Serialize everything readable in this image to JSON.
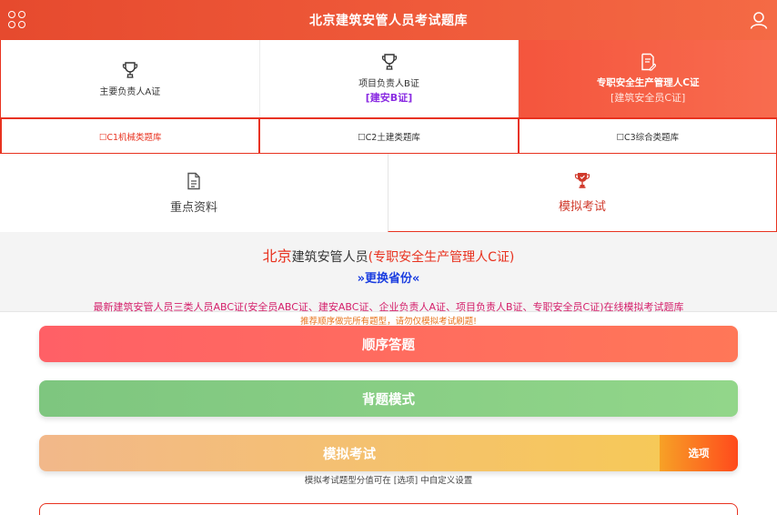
{
  "header": {
    "title": "北京建筑安管人员考试题库"
  },
  "certificates": [
    {
      "name": "主要负责人A证",
      "sub": "",
      "icon": "trophy-icon"
    },
    {
      "name": "项目负责人B证",
      "sub": "[建安B证]",
      "icon": "trophy-icon"
    },
    {
      "name": "专职安全生产管理人C证",
      "sub": "[建筑安全员C证]",
      "icon": "document-edit-icon"
    }
  ],
  "banks": [
    {
      "label": "☐C1机械类题库"
    },
    {
      "label": "☐C2土建类题库"
    },
    {
      "label": "☐C3综合类题库"
    }
  ],
  "features": [
    {
      "label": "重点资料",
      "icon": "document-icon"
    },
    {
      "label": "模拟考试",
      "icon": "trophy-icon"
    }
  ],
  "info": {
    "city": "北京",
    "title_middle": "建筑安管人员",
    "category": "(专职安全生产管理人C证)",
    "switch_province": "»更换省份«"
  },
  "notices": {
    "line1": "最新建筑安管人员三类人员ABC证(安全员ABC证、建安ABC证、企业负责人A证、项目负责人B证、专职安全员C证)在线模拟考试题库",
    "line2": "推荐顺序做完所有题型，请勿仅模拟考试刷题!"
  },
  "buttons": {
    "order": "顺序答题",
    "memory": "背题模式",
    "exam": "模拟考试",
    "options": "选项"
  },
  "exam_note": "模拟考试题型分值可在 [选项] 中自定义设置",
  "colors": {
    "accent": "#e8321f",
    "header_start": "#e64a2e",
    "link_blue": "#1a3de0"
  }
}
